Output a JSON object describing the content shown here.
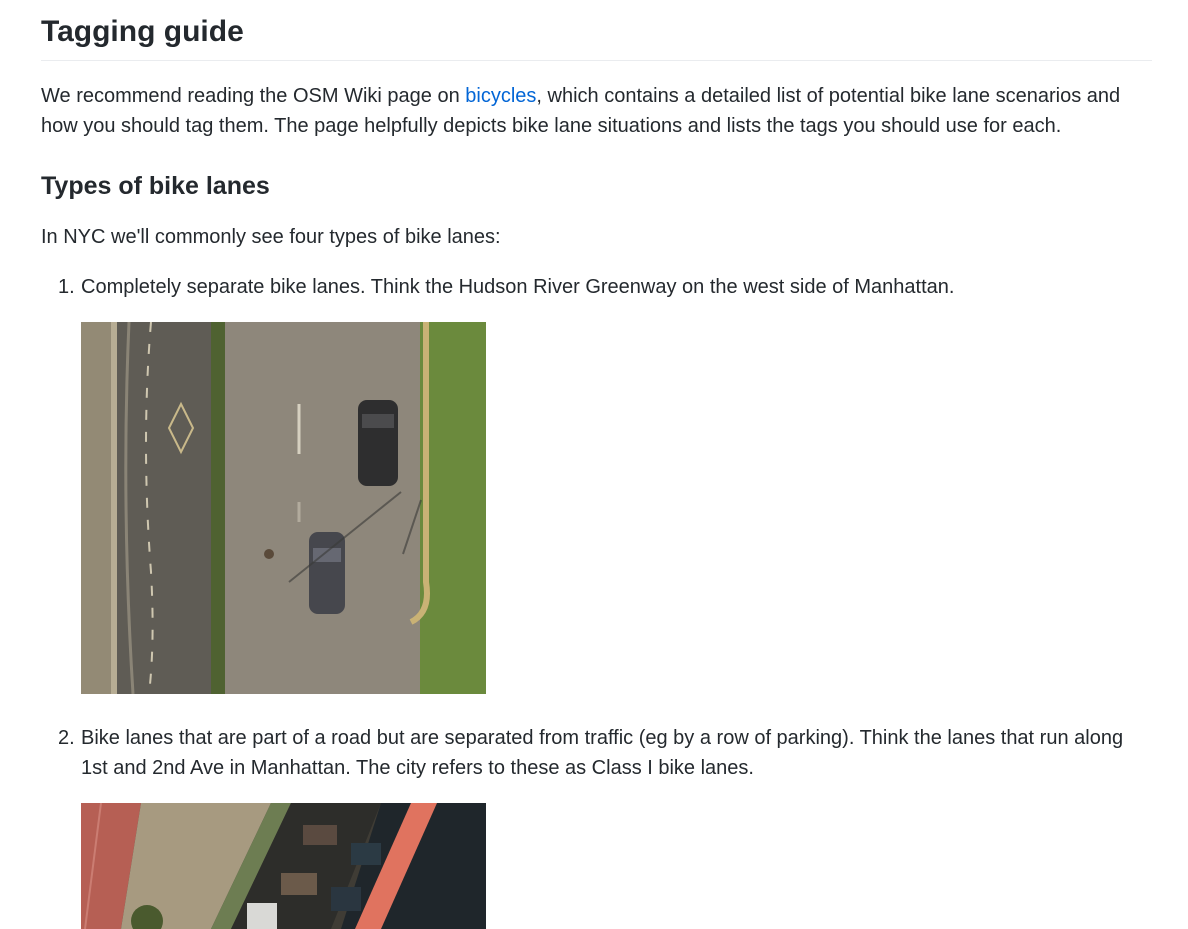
{
  "heading": "Tagging guide",
  "intro": {
    "before_link": "We recommend reading the OSM Wiki page on ",
    "link": "bicycles",
    "after_link": ", which contains a detailed list of potential bike lane scenarios and how you should tag them. The page helpfully depicts bike lane situations and lists the tags you should use for each."
  },
  "subheading": "Types of bike lanes",
  "lead": "In NYC we'll commonly see four types of bike lanes:",
  "list": [
    {
      "number": "1.",
      "text": "Completely separate bike lanes. Think the Hudson River Greenway on the west side of Manhattan."
    },
    {
      "number": "2.",
      "text": "Bike lanes that are part of a road but are separated from traffic (eg by a row of parking). Think the lanes that run along 1st and 2nd Ave in Manhattan. The city refers to these as Class I bike lanes."
    }
  ]
}
